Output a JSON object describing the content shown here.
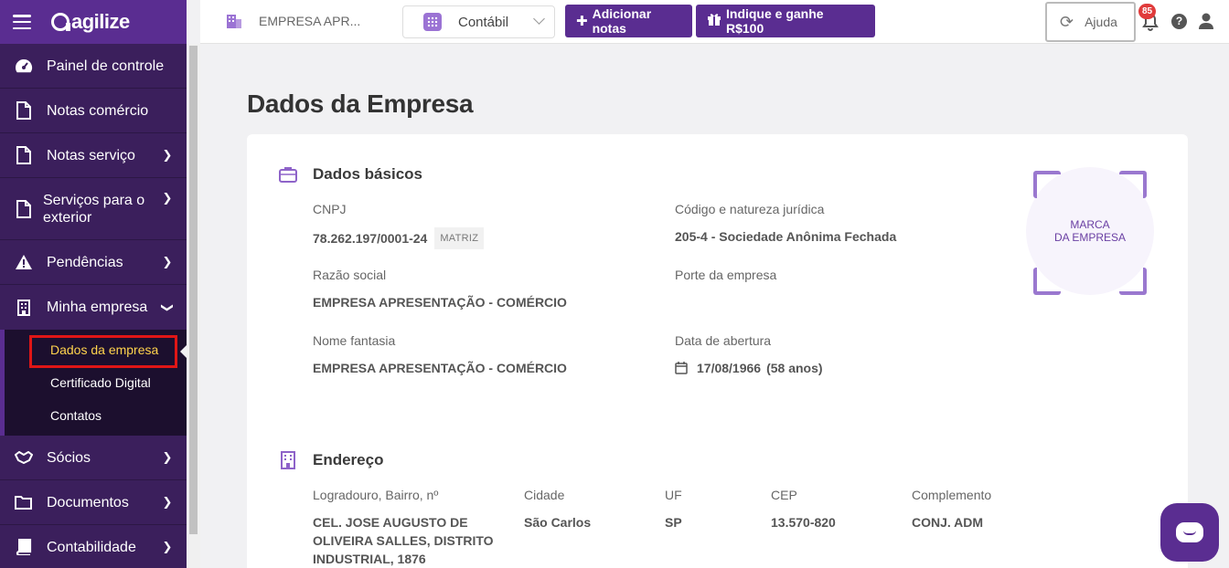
{
  "app": {
    "logo_text": "agilize"
  },
  "topbar": {
    "company": "EMPRESA APR...",
    "module": "Contábil",
    "add_notes": "Adicionar notas",
    "refer": "Indique e ganhe R$100",
    "help": "Ajuda",
    "notif_count": "85"
  },
  "sidebar": {
    "items": [
      {
        "label": "Painel de controle",
        "icon": "dashboard-icon"
      },
      {
        "label": "Notas comércio",
        "icon": "document-icon"
      },
      {
        "label": "Notas serviço",
        "icon": "document-icon"
      },
      {
        "label": "Serviços para o exterior",
        "icon": "document-icon"
      },
      {
        "label": "Pendências",
        "icon": "warning-icon"
      },
      {
        "label": "Minha empresa",
        "icon": "building-icon"
      },
      {
        "label": "Sócios",
        "icon": "handshake-icon"
      },
      {
        "label": "Documentos",
        "icon": "folder-icon"
      },
      {
        "label": "Contabilidade",
        "icon": "book-icon"
      }
    ],
    "submenu": [
      "Dados da empresa",
      "Certificado Digital",
      "Contatos"
    ]
  },
  "page": {
    "title": "Dados da Empresa"
  },
  "basic": {
    "heading": "Dados básicos",
    "cnpj_label": "CNPJ",
    "cnpj_value": "78.262.197/0001-24",
    "cnpj_tag": "MATRIZ",
    "nature_label": "Código e natureza jurídica",
    "nature_value": "205-4 - Sociedade Anônima Fechada",
    "razao_label": "Razão social",
    "razao_value": "EMPRESA APRESENTAÇÃO - COMÉRCIO",
    "porte_label": "Porte da empresa",
    "fantasia_label": "Nome fantasia",
    "fantasia_value": "EMPRESA APRESENTAÇÃO - COMÉRCIO",
    "abertura_label": "Data de abertura",
    "abertura_date": "17/08/1966",
    "abertura_age": "(58 anos)",
    "marca_line1": "MARCA",
    "marca_line2": "DA EMPRESA"
  },
  "address": {
    "heading": "Endereço",
    "logradouro_label": "Logradouro, Bairro, nº",
    "logradouro_value": "CEL. JOSE AUGUSTO DE OLIVEIRA SALLES, DISTRITO INDUSTRIAL, 1876",
    "cidade_label": "Cidade",
    "cidade_value": "São Carlos",
    "uf_label": "UF",
    "uf_value": "SP",
    "cep_label": "CEP",
    "cep_value": "13.570-820",
    "complemento_label": "Complemento",
    "complemento_value": "CONJ. ADM"
  },
  "colors": {
    "brand": "#5a2d91",
    "sidebar": "#3b1f5c",
    "highlight": "#e01616",
    "active_text": "#ffd34d"
  }
}
